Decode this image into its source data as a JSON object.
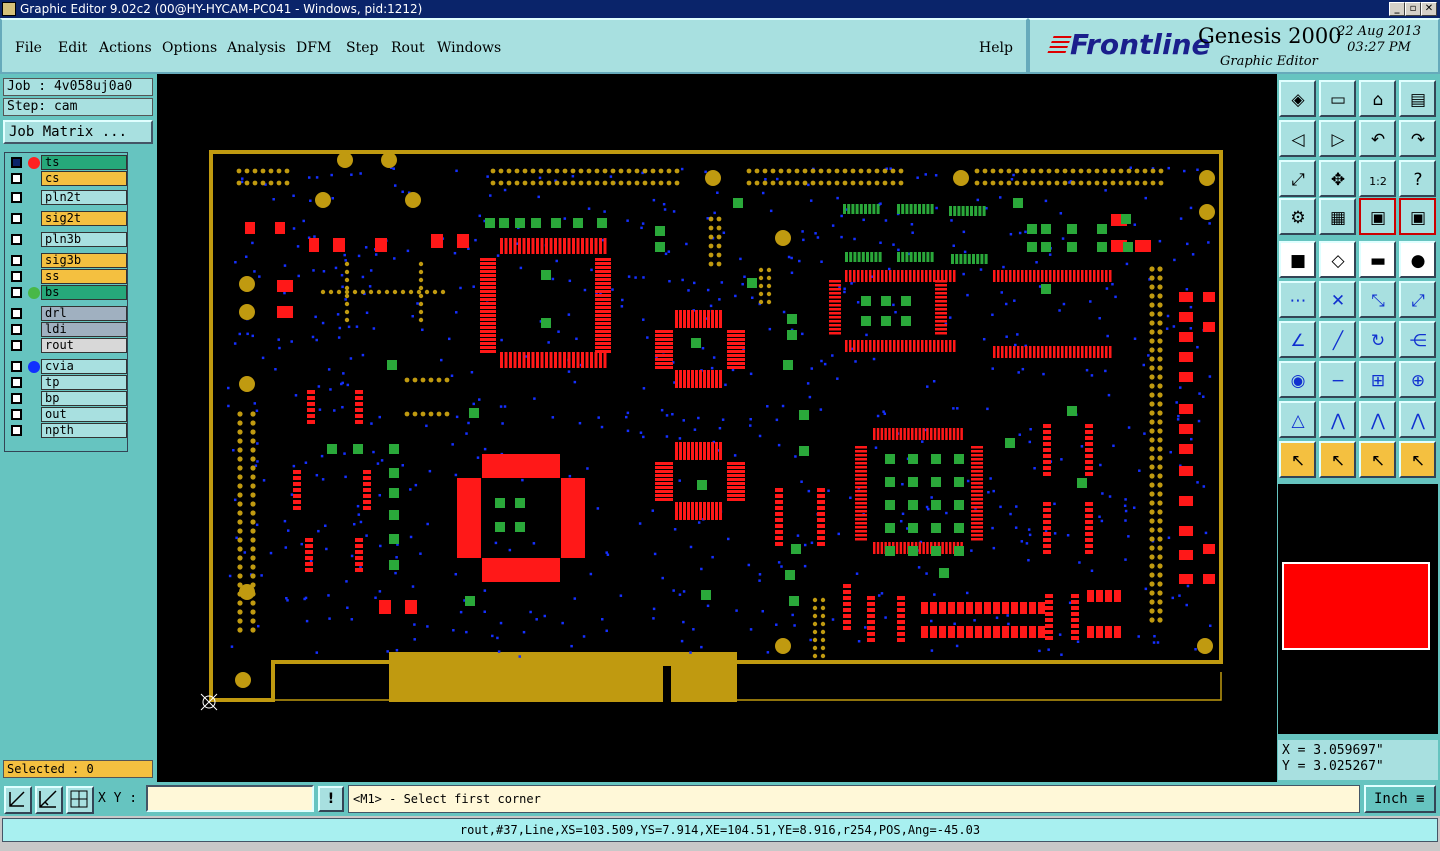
{
  "window": {
    "title": "Graphic Editor 9.02c2 (00@HY-HYCAM-PC041 - Windows, pid:1212)"
  },
  "menu": [
    "File",
    "Edit",
    "Actions",
    "Options",
    "Analysis",
    "DFM",
    "Step",
    "Rout",
    "Windows"
  ],
  "help_label": "Help",
  "brand": {
    "logo": "Frontline",
    "product": "Genesis 2000",
    "subtitle": "Graphic Editor",
    "date": "22 Aug 2013",
    "time": "03:27 PM"
  },
  "job": {
    "job_label": "Job : 4v058uj0a0",
    "step_label": "Step: cam",
    "job_matrix": "Job Matrix ..."
  },
  "layers": [
    {
      "name": "ts",
      "color": "#26a87a",
      "dot": "#ff2020",
      "selected": true
    },
    {
      "name": "cs",
      "color": "#f4c040"
    },
    {
      "name": "pln2t",
      "color": "#a8e0e0"
    },
    {
      "name": "sig2t",
      "color": "#f4c040"
    },
    {
      "name": "pln3b",
      "color": "#a8e0e0"
    },
    {
      "name": "sig3b",
      "color": "#f4c040"
    },
    {
      "name": "ss",
      "color": "#f4c040"
    },
    {
      "name": "bs",
      "color": "#26a87a",
      "dot": "#48b848"
    },
    {
      "name": "drl",
      "color": "#a0b0c0"
    },
    {
      "name": "ldi",
      "color": "#a0b0c0"
    },
    {
      "name": "rout",
      "color": "#d8d8d8"
    },
    {
      "name": "cvia",
      "color": "#a8e0e0",
      "dot": "#1030ff"
    },
    {
      "name": "tp",
      "color": "#a8e0e0"
    },
    {
      "name": "bp",
      "color": "#a8e0e0"
    },
    {
      "name": "out",
      "color": "#a8e0e0"
    },
    {
      "name": "npth",
      "color": "#a8e0e0"
    }
  ],
  "selected_label": "Selected : 0",
  "coords": {
    "x": "X = 3.059697\"",
    "y": "Y = 3.025267\""
  },
  "command": {
    "xy_label": "X Y :",
    "xy_value": "",
    "excl": "!",
    "prompt": "<M1> - Select first corner",
    "units": "Inch"
  },
  "status": "rout,#37,Line,XS=103.509,YS=7.914,XE=104.51,YE=8.916,r254,POS,Ang=-45.03",
  "colors": {
    "board": "#c09a10",
    "pad": "#ff1818",
    "green": "#2aa83a",
    "via": "#1530ff"
  }
}
